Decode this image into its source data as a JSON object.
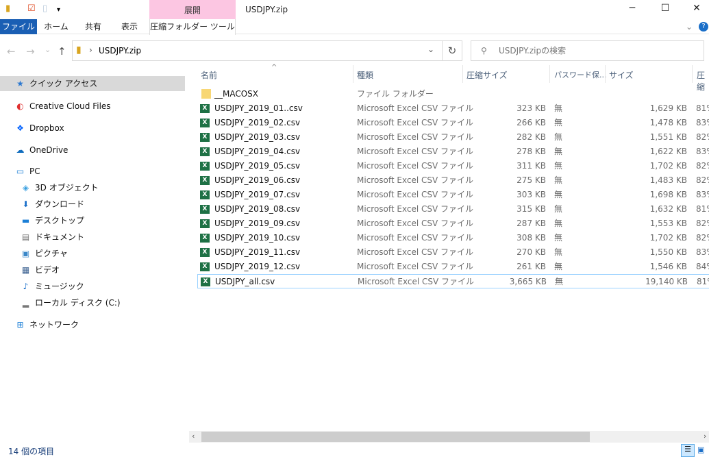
{
  "window": {
    "title": "USDJPY.zip",
    "context_tab": "展開",
    "minimize": "─",
    "maximize": "☐",
    "close": "✕"
  },
  "ribbon": {
    "tabs": [
      "ファイル",
      "ホーム",
      "共有",
      "表示"
    ],
    "tools_tab": "圧縮フォルダー ツール",
    "help": "?"
  },
  "nav": {
    "back": "←",
    "forward": "→",
    "recent": "⌄",
    "up": "↑",
    "path": "USDJPY.zip",
    "path_sep": "›",
    "refresh": "↻",
    "dropdown": "⌄",
    "search_placeholder": "USDJPY.zipの検索"
  },
  "sidebar": [
    {
      "label": "クイック アクセス",
      "icon": "star-icon",
      "glyph": "★",
      "color": "#2b78d0",
      "selected": true
    },
    {
      "label": "Creative Cloud Files",
      "icon": "creative-cloud-icon",
      "glyph": "◐",
      "color": "#e03030"
    },
    {
      "label": "Dropbox",
      "icon": "dropbox-icon",
      "glyph": "❖",
      "color": "#0061fe"
    },
    {
      "label": "OneDrive",
      "icon": "onedrive-icon",
      "glyph": "☁",
      "color": "#0f6cbd"
    },
    {
      "label": "PC",
      "icon": "pc-icon",
      "glyph": "▭",
      "color": "#1b7fd6"
    },
    {
      "label": "3D オブジェクト",
      "icon": "3d-objects-icon",
      "glyph": "◈",
      "color": "#3aa0e0",
      "sub": true
    },
    {
      "label": "ダウンロード",
      "icon": "download-icon",
      "glyph": "⬇",
      "color": "#1a6fc9",
      "sub": true
    },
    {
      "label": "デスクトップ",
      "icon": "desktop-icon",
      "glyph": "▬",
      "color": "#1b7fd6",
      "sub": true
    },
    {
      "label": "ドキュメント",
      "icon": "documents-icon",
      "glyph": "▤",
      "color": "#777",
      "sub": true
    },
    {
      "label": "ピクチャ",
      "icon": "pictures-icon",
      "glyph": "▣",
      "color": "#3a87c8",
      "sub": true
    },
    {
      "label": "ビデオ",
      "icon": "videos-icon",
      "glyph": "▦",
      "color": "#3a6090",
      "sub": true
    },
    {
      "label": "ミュージック",
      "icon": "music-icon",
      "glyph": "♪",
      "color": "#1a6fc9",
      "sub": true
    },
    {
      "label": "ローカル ディスク (C:)",
      "icon": "local-disk-icon",
      "glyph": "▂",
      "color": "#777",
      "sub": true
    },
    {
      "label": "ネットワーク",
      "icon": "network-icon",
      "glyph": "⊞",
      "color": "#1b7fd6"
    }
  ],
  "columns": [
    "名前",
    "種類",
    "圧縮サイズ",
    "パスワード保...",
    "サイズ",
    "圧縮"
  ],
  "sort_indicator": "^",
  "files": [
    {
      "name": "__MACOSX",
      "type": "ファイル フォルダー",
      "csize": "",
      "pw": "",
      "size": "",
      "ratio": "",
      "folder": true
    },
    {
      "name": "USDJPY_2019_01..csv",
      "type": "Microsoft Excel CSV ファイル",
      "csize": "323 KB",
      "pw": "無",
      "size": "1,629 KB",
      "ratio": "81%"
    },
    {
      "name": "USDJPY_2019_02.csv",
      "type": "Microsoft Excel CSV ファイル",
      "csize": "266 KB",
      "pw": "無",
      "size": "1,478 KB",
      "ratio": "83%"
    },
    {
      "name": "USDJPY_2019_03.csv",
      "type": "Microsoft Excel CSV ファイル",
      "csize": "282 KB",
      "pw": "無",
      "size": "1,551 KB",
      "ratio": "82%"
    },
    {
      "name": "USDJPY_2019_04.csv",
      "type": "Microsoft Excel CSV ファイル",
      "csize": "278 KB",
      "pw": "無",
      "size": "1,622 KB",
      "ratio": "83%"
    },
    {
      "name": "USDJPY_2019_05.csv",
      "type": "Microsoft Excel CSV ファイル",
      "csize": "311 KB",
      "pw": "無",
      "size": "1,702 KB",
      "ratio": "82%"
    },
    {
      "name": "USDJPY_2019_06.csv",
      "type": "Microsoft Excel CSV ファイル",
      "csize": "275 KB",
      "pw": "無",
      "size": "1,483 KB",
      "ratio": "82%"
    },
    {
      "name": "USDJPY_2019_07.csv",
      "type": "Microsoft Excel CSV ファイル",
      "csize": "303 KB",
      "pw": "無",
      "size": "1,698 KB",
      "ratio": "83%"
    },
    {
      "name": "USDJPY_2019_08.csv",
      "type": "Microsoft Excel CSV ファイル",
      "csize": "315 KB",
      "pw": "無",
      "size": "1,632 KB",
      "ratio": "81%"
    },
    {
      "name": "USDJPY_2019_09.csv",
      "type": "Microsoft Excel CSV ファイル",
      "csize": "287 KB",
      "pw": "無",
      "size": "1,553 KB",
      "ratio": "82%"
    },
    {
      "name": "USDJPY_2019_10.csv",
      "type": "Microsoft Excel CSV ファイル",
      "csize": "308 KB",
      "pw": "無",
      "size": "1,702 KB",
      "ratio": "82%"
    },
    {
      "name": "USDJPY_2019_11.csv",
      "type": "Microsoft Excel CSV ファイル",
      "csize": "270 KB",
      "pw": "無",
      "size": "1,550 KB",
      "ratio": "83%"
    },
    {
      "name": "USDJPY_2019_12.csv",
      "type": "Microsoft Excel CSV ファイル",
      "csize": "261 KB",
      "pw": "無",
      "size": "1,546 KB",
      "ratio": "84%"
    },
    {
      "name": "USDJPY_all.csv",
      "type": "Microsoft Excel CSV ファイル",
      "csize": "3,665 KB",
      "pw": "無",
      "size": "19,140 KB",
      "ratio": "81%",
      "selected": true
    }
  ],
  "status": {
    "count": "14 個の項目"
  },
  "colors": {
    "accent": "#1a5fb4",
    "context_tab": "#fcc6e2",
    "selection": "#cce8ff"
  }
}
